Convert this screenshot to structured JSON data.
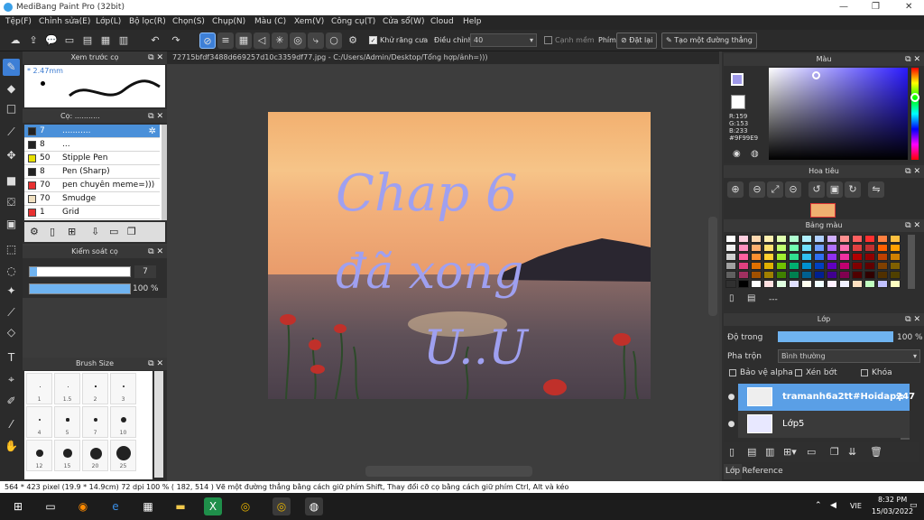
{
  "window": {
    "title": "MediBang Paint Pro (32bit)"
  },
  "menu": [
    "Tệp(F)",
    "Chỉnh sửa(E)",
    "Lớp(L)",
    "Bộ lọc(R)",
    "Chọn(S)",
    "Chụp(N)",
    "Màu (C)",
    "Xem(V)",
    "Công cụ(T)",
    "Cửa sổ(W)",
    "Cloud",
    "Help"
  ],
  "toolbar": {
    "antialias_label": "Khử răng cưa",
    "adjust_label": "Điều chỉnh",
    "adjust_value": "40",
    "edge_label": "Cạnh mềm",
    "key_label": "Phím",
    "reset_label": "Đặt lại",
    "line_label": "Tạo một đường thẳng"
  },
  "preview": {
    "title": "Xem trước cọ",
    "size": "* 2.47mm"
  },
  "brush": {
    "title": "Cọ: ...........",
    "items": [
      {
        "size": "7",
        "name": "...........",
        "color": "#222222"
      },
      {
        "size": "8",
        "name": "...",
        "color": "#222222"
      },
      {
        "size": "50",
        "name": "Stipple Pen",
        "color": "#e8e000"
      },
      {
        "size": "8",
        "name": "Pen (Sharp)",
        "color": "#222222"
      },
      {
        "size": "70",
        "name": "pen chuyên meme=)))",
        "color": "#e83030"
      },
      {
        "size": "70",
        "name": "Smudge",
        "color": "#f0e0c0"
      },
      {
        "size": "1",
        "name": "Grid",
        "color": "#e83030"
      }
    ]
  },
  "control": {
    "title": "Kiểm soát cọ",
    "size_value": "7",
    "opacity_value": "100 %",
    "size_fraction": 0.07,
    "opacity_fraction": 1.0
  },
  "brushsize": {
    "title": "Brush Size",
    "labels": [
      "1",
      "1.5",
      "2",
      "3",
      "4",
      "5",
      "7",
      "10",
      "12",
      "15",
      "20",
      "25"
    ]
  },
  "canvas": {
    "tab": "72715bfdf3488d669257d10c3359df77.jpg - C:/Users/Admin/Desktop/Tổng hợp/ảnh=)))",
    "text_line1": "Chap 6",
    "text_line2": "đã xong",
    "text_line3": "U..U"
  },
  "color": {
    "title": "Màu",
    "r": "R:159",
    "g": "G:153",
    "b": "B:233",
    "hex": "#9F99E9",
    "value": "#9F99E9"
  },
  "navigator": {
    "title": "Hoa tiêu"
  },
  "palette": {
    "title": "Bảng màu",
    "footer": "---",
    "colors": [
      "#ffffff",
      "#ffd0e0",
      "#ffd8b0",
      "#fff0b0",
      "#e0ffb0",
      "#b0ffd0",
      "#b0f0ff",
      "#b0d0ff",
      "#d0b0ff",
      "#ff9090",
      "#ff6060",
      "#ff3030",
      "#ff8040",
      "#ffc040",
      "#f0f0f0",
      "#ff90c0",
      "#ffb070",
      "#ffe070",
      "#c0ff70",
      "#70ffb0",
      "#70e0ff",
      "#70a0ff",
      "#b070ff",
      "#ff70b0",
      "#e04040",
      "#c03030",
      "#ff6000",
      "#ffa000",
      "#d0d0d0",
      "#ff60a0",
      "#ff9030",
      "#ffd030",
      "#a0f030",
      "#30e090",
      "#30c0f0",
      "#3070f0",
      "#9030f0",
      "#f030a0",
      "#b00000",
      "#900000",
      "#c04000",
      "#d08000",
      "#a0a0a0",
      "#e04080",
      "#e07000",
      "#e0b000",
      "#70c000",
      "#00b070",
      "#0090d0",
      "#0040c0",
      "#6000c0",
      "#c00070",
      "#800000",
      "#600000",
      "#804000",
      "#806000",
      "#606060",
      "#a03060",
      "#a05000",
      "#a08000",
      "#408000",
      "#008050",
      "#006090",
      "#002090",
      "#400090",
      "#800050",
      "#500000",
      "#300000",
      "#503000",
      "#504000",
      "#303030",
      "#000000",
      "#ffffff",
      "#ffe0e0",
      "#e0ffe0",
      "#e0e0ff",
      "#fffff0",
      "#f0ffff",
      "#fff0ff",
      "#f0f0ff",
      "#ffe0c0",
      "#c0ffc0",
      "#c0c0ff",
      "#ffffc0"
    ]
  },
  "layers": {
    "title": "Lớp",
    "opacity_label": "Độ trong",
    "opacity_value": "100 %",
    "blend_label": "Pha trộn",
    "blend_value": "Bình thường",
    "protect_label": "Bảo vệ alpha",
    "clip_label": "Xén bớt",
    "lock_label": "Khóa",
    "items": [
      {
        "name": "tramanh6a2tt#Hoidap247"
      },
      {
        "name": "Lớp5"
      }
    ],
    "tab1": "Lớp",
    "tab2": "Reference"
  },
  "status": {
    "info": "564 * 423 pixel   (19.9 * 14.9cm)   72 dpi   100 %   ( 182, 514 )   Vẽ một đường thẳng bằng cách giữ phím Shift, Thay đổi cỡ cọ bằng cách giữ phím Ctrl, Alt và kéo"
  },
  "taskbar": {
    "lang": "VIE",
    "time": "8:32 PM",
    "date": "15/03/2022"
  }
}
